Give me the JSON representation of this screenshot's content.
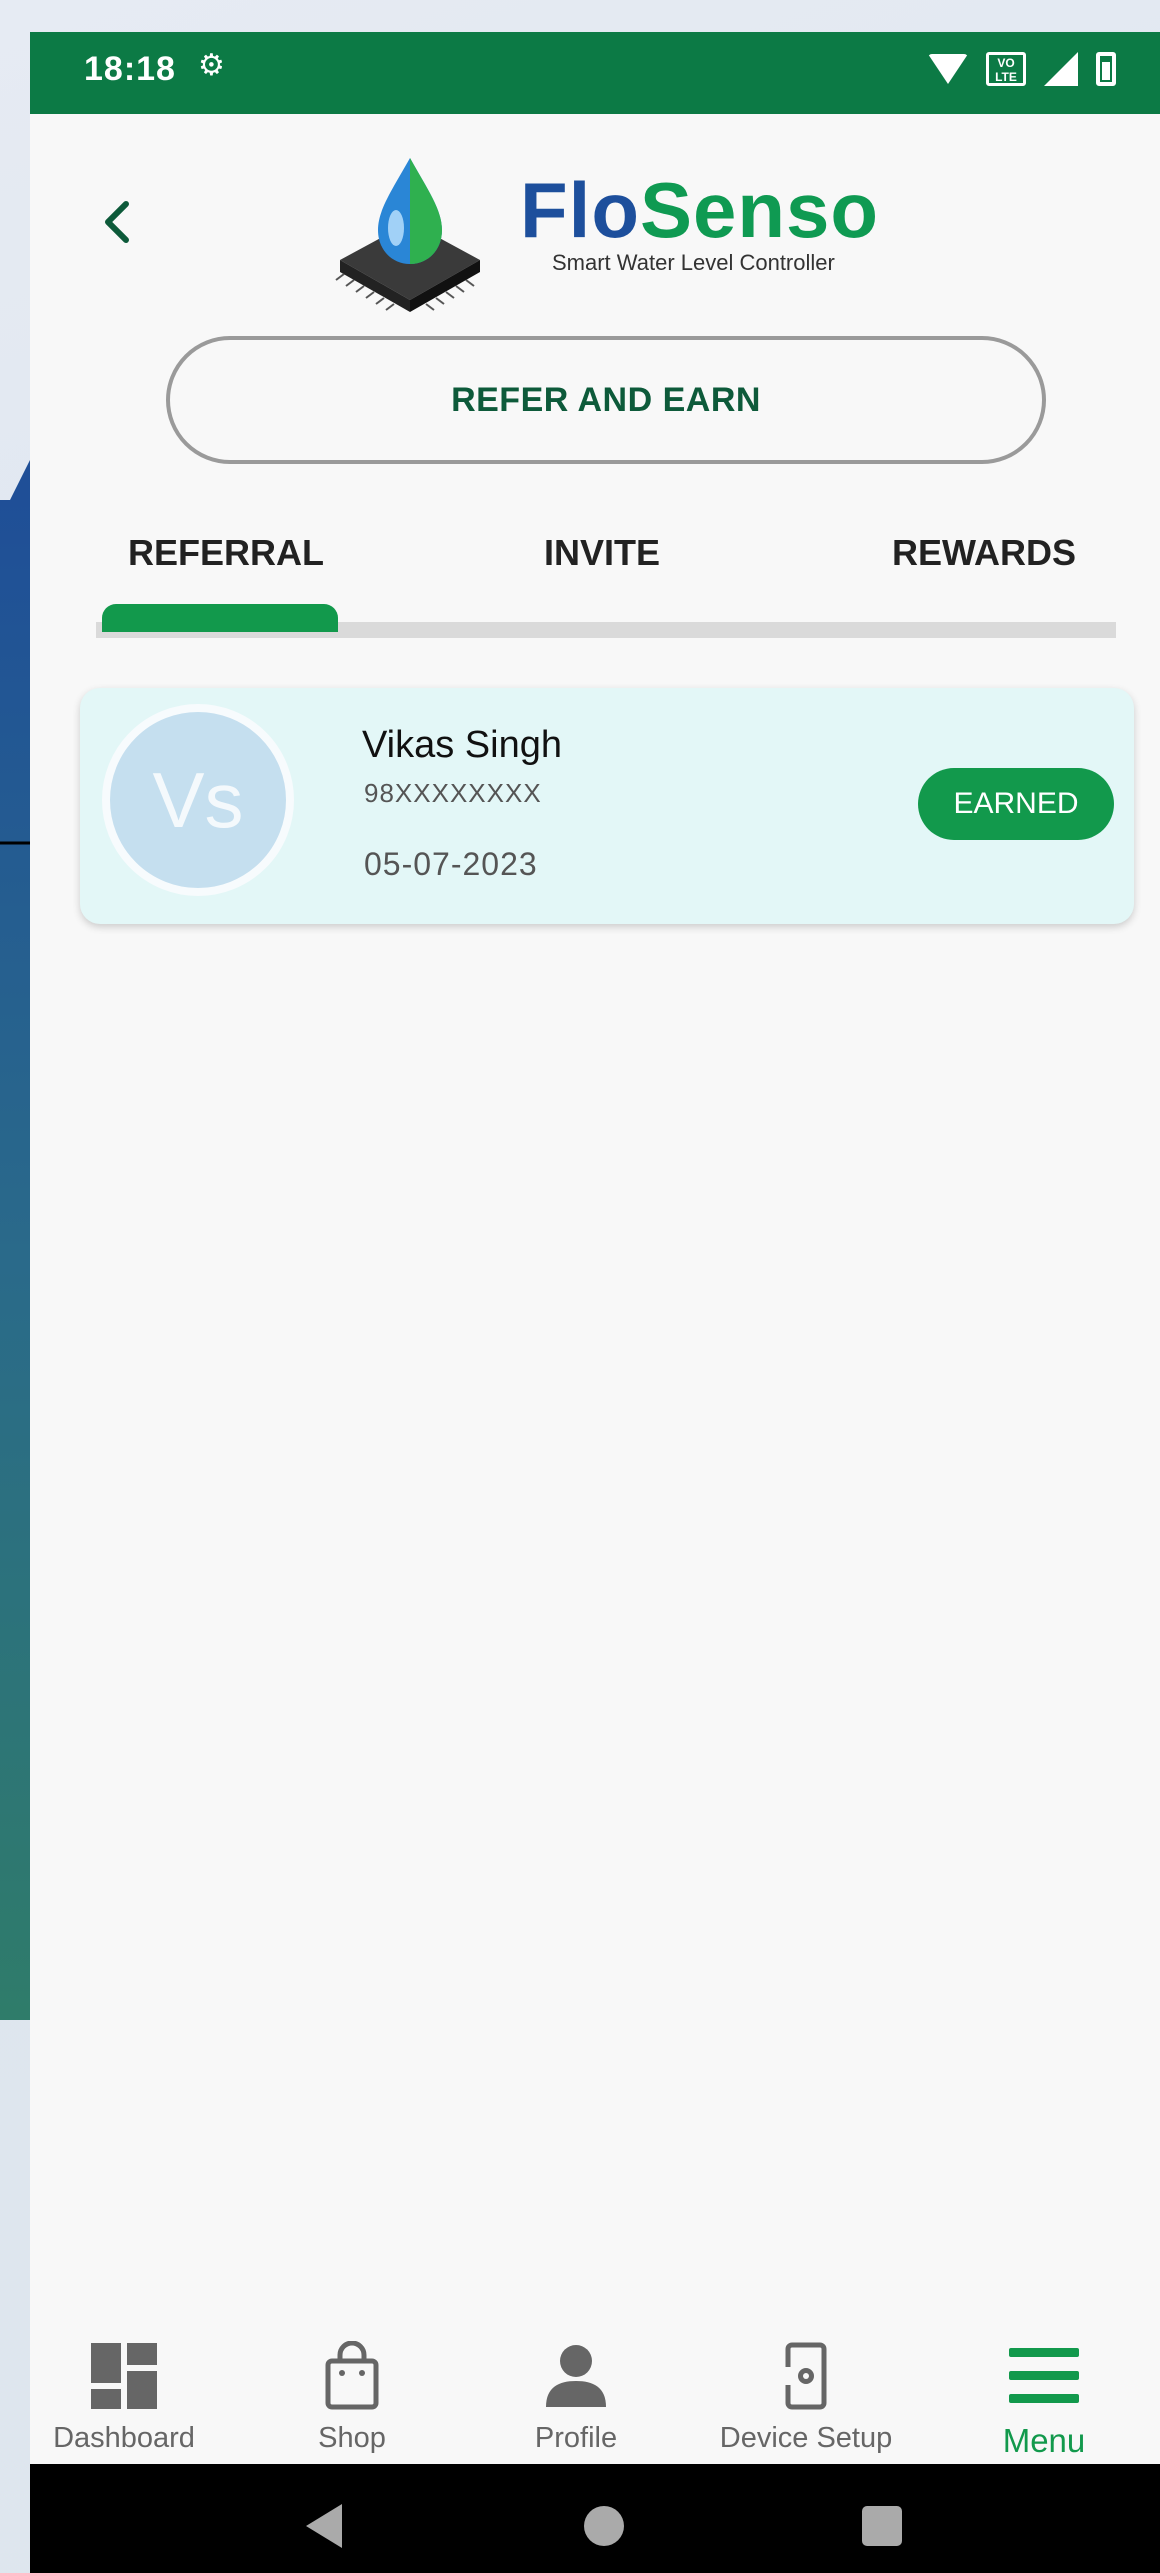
{
  "status_bar": {
    "time": "18:18",
    "lte_label": "VO\nLTE"
  },
  "header": {
    "brand_part1": "Flo",
    "brand_part2": "Senso",
    "tagline": "Smart Water Level Controller",
    "page_title": "REFER AND EARN"
  },
  "tabs": [
    {
      "label": "REFERRAL",
      "active": true
    },
    {
      "label": "INVITE",
      "active": false
    },
    {
      "label": "REWARDS",
      "active": false
    }
  ],
  "referrals": [
    {
      "initials": "Vs",
      "name": "Vikas Singh",
      "phone": "98XXXXXXXX",
      "date": "05-07-2023",
      "status": "EARNED"
    }
  ],
  "bottom_nav": [
    {
      "label": "Dashboard",
      "icon": "dashboard-icon"
    },
    {
      "label": "Shop",
      "icon": "shopping-bag-icon"
    },
    {
      "label": "Profile",
      "icon": "person-icon"
    },
    {
      "label": "Device Setup",
      "icon": "device-setup-icon"
    },
    {
      "label": "Menu",
      "icon": "menu-icon",
      "active": true
    }
  ],
  "colors": {
    "brand_green": "#12994c",
    "status_bar": "#0c7a45",
    "brand_blue": "#1d4f9c",
    "card_bg": "#e3f7f7"
  }
}
